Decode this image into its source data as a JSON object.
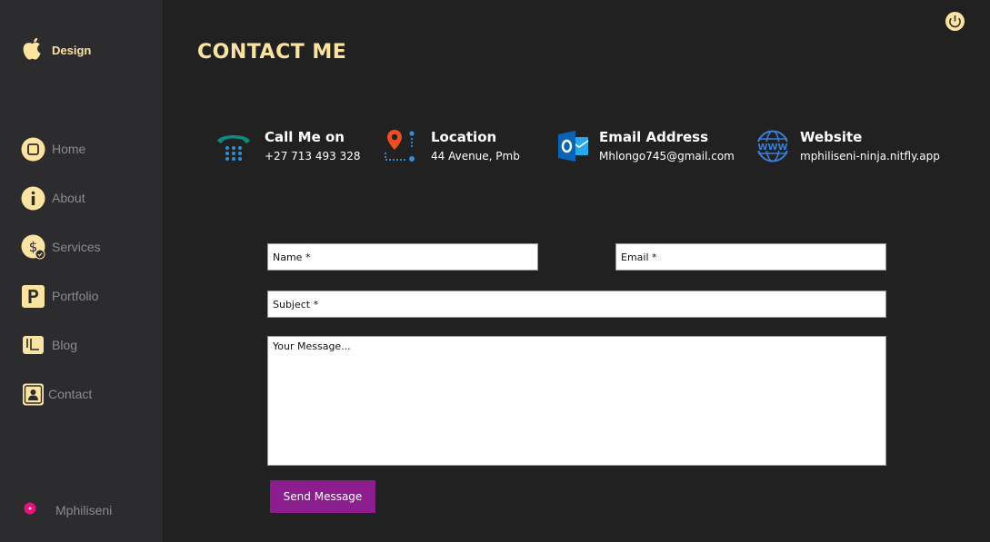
{
  "sidebar": {
    "brand": {
      "label": "Design",
      "icon": "apple-icon"
    },
    "items": [
      {
        "label": "Home",
        "icon": "home-icon"
      },
      {
        "label": "About",
        "icon": "info-icon"
      },
      {
        "label": "Services",
        "icon": "dollar-icon"
      },
      {
        "label": "Portfolio",
        "icon": "portfolio-p-icon"
      },
      {
        "label": "Blog",
        "icon": "blog-icon"
      },
      {
        "label": "Contact",
        "icon": "contact-icon"
      }
    ],
    "user": {
      "name": "Mphiliseni",
      "icon": "user-dot-icon"
    }
  },
  "header": {
    "title": "CONTACT ME",
    "power_icon": "power-icon"
  },
  "contacts": [
    {
      "heading": "Call Me on",
      "value": "+27 713 493 328",
      "icon": "phone-icon"
    },
    {
      "heading": "Location",
      "value": "44 Avenue, Pmb",
      "icon": "location-icon"
    },
    {
      "heading": "Email Address",
      "value": "Mhlongo745@gmail.com",
      "icon": "outlook-icon"
    },
    {
      "heading": "Website",
      "value": "mphiliseni-ninja.nitfly.app",
      "icon": "globe-www-icon"
    }
  ],
  "form": {
    "name_placeholder": "Name *",
    "email_placeholder": "Email *",
    "subject_placeholder": "Subject *",
    "message_placeholder": "Your Message...",
    "send_label": "Send Message"
  },
  "colors": {
    "accent": "#fbe3a2",
    "button": "#8b1d8e",
    "sidebar_bg": "#2c2b2e",
    "main_bg": "#222122",
    "user_dot": "#e8127c"
  }
}
